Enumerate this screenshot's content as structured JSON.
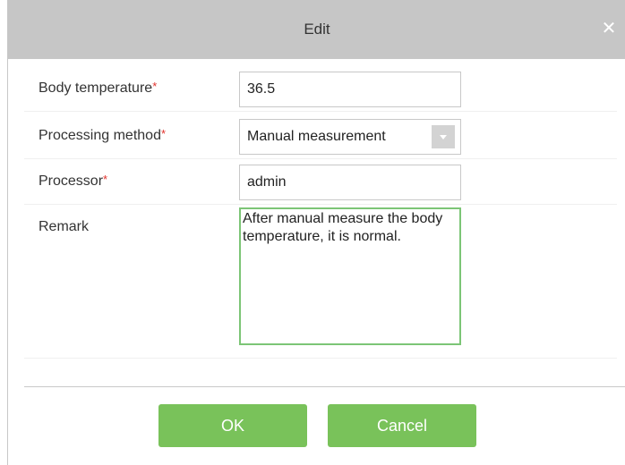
{
  "dialog": {
    "title": "Edit",
    "close_icon": "close-icon"
  },
  "form": {
    "body_temperature": {
      "label": "Body temperature",
      "required_mark": "*",
      "value": "36.5"
    },
    "processing_method": {
      "label": "Processing method",
      "required_mark": "*",
      "value": "Manual measurement"
    },
    "processor": {
      "label": "Processor",
      "required_mark": "*",
      "value": "admin"
    },
    "remark": {
      "label": "Remark",
      "value": "After manual measure the body temperature, it is normal."
    }
  },
  "buttons": {
    "ok_label": "OK",
    "cancel_label": "Cancel"
  },
  "colors": {
    "titlebar": "#c6c6c6",
    "accent_green": "#79c25a",
    "focus_border": "#7cc576",
    "required": "#e0302a"
  }
}
